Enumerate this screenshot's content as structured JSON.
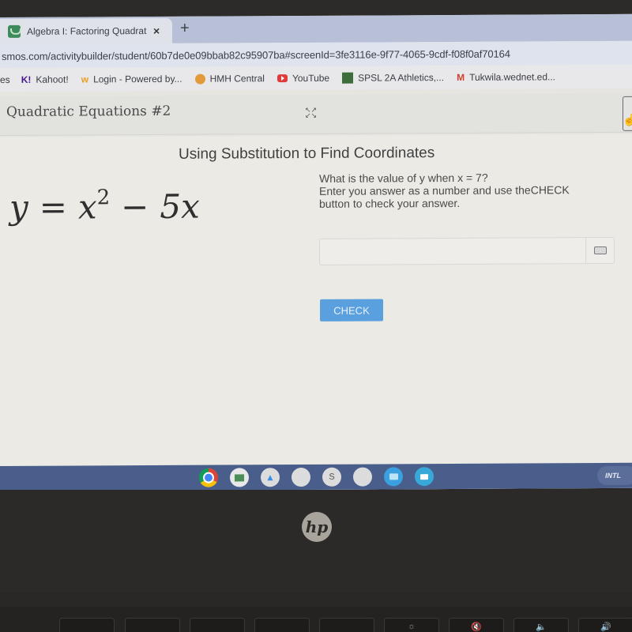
{
  "browser": {
    "tab": {
      "title": "Algebra I: Factoring Quadratic E",
      "close_label": "×",
      "favicon": "desmos-favicon"
    },
    "new_tab_label": "+",
    "url": "smos.com/activitybuilder/student/60b7de0e09bbab82c95907ba#screenId=3fe3116e-9f77-4065-9cdf-f08f0af70164",
    "bookmarks": [
      {
        "label": "es",
        "icon": ""
      },
      {
        "label": "Kahoot!",
        "icon": "K!"
      },
      {
        "label": "Login - Powered by...",
        "icon": "w"
      },
      {
        "label": "HMH Central",
        "icon": "hmh-dot-icon"
      },
      {
        "label": "YouTube",
        "icon": "youtube-icon"
      },
      {
        "label": "SPSL 2A Athletics,...",
        "icon": "spsl-icon"
      },
      {
        "label": "Tukwila.wednet.ed...",
        "icon": "M"
      }
    ]
  },
  "app": {
    "title": "Quadratic Equations #2",
    "expand_icon": "⤢"
  },
  "screen": {
    "title": "Using Substitution to Find Coordinates",
    "equation": {
      "lhs": "y",
      "equals": "=",
      "term1": "x",
      "exponent": "2",
      "minus": "−",
      "term2": "5x"
    },
    "prompt_line1": "What is the value of y when x = 7?",
    "prompt_line2": "Enter you answer as a number and use theCHECK",
    "prompt_line3": "button to check your answer.",
    "answer_value": "",
    "check_label": "CHECK"
  },
  "shelf": {
    "apps": [
      "chrome",
      "classroom",
      "google-drive",
      "app",
      "s-app",
      "app",
      "files",
      "meet"
    ],
    "s_label": "S",
    "ime_label": "INTL"
  },
  "hardware": {
    "logo": "hp"
  }
}
